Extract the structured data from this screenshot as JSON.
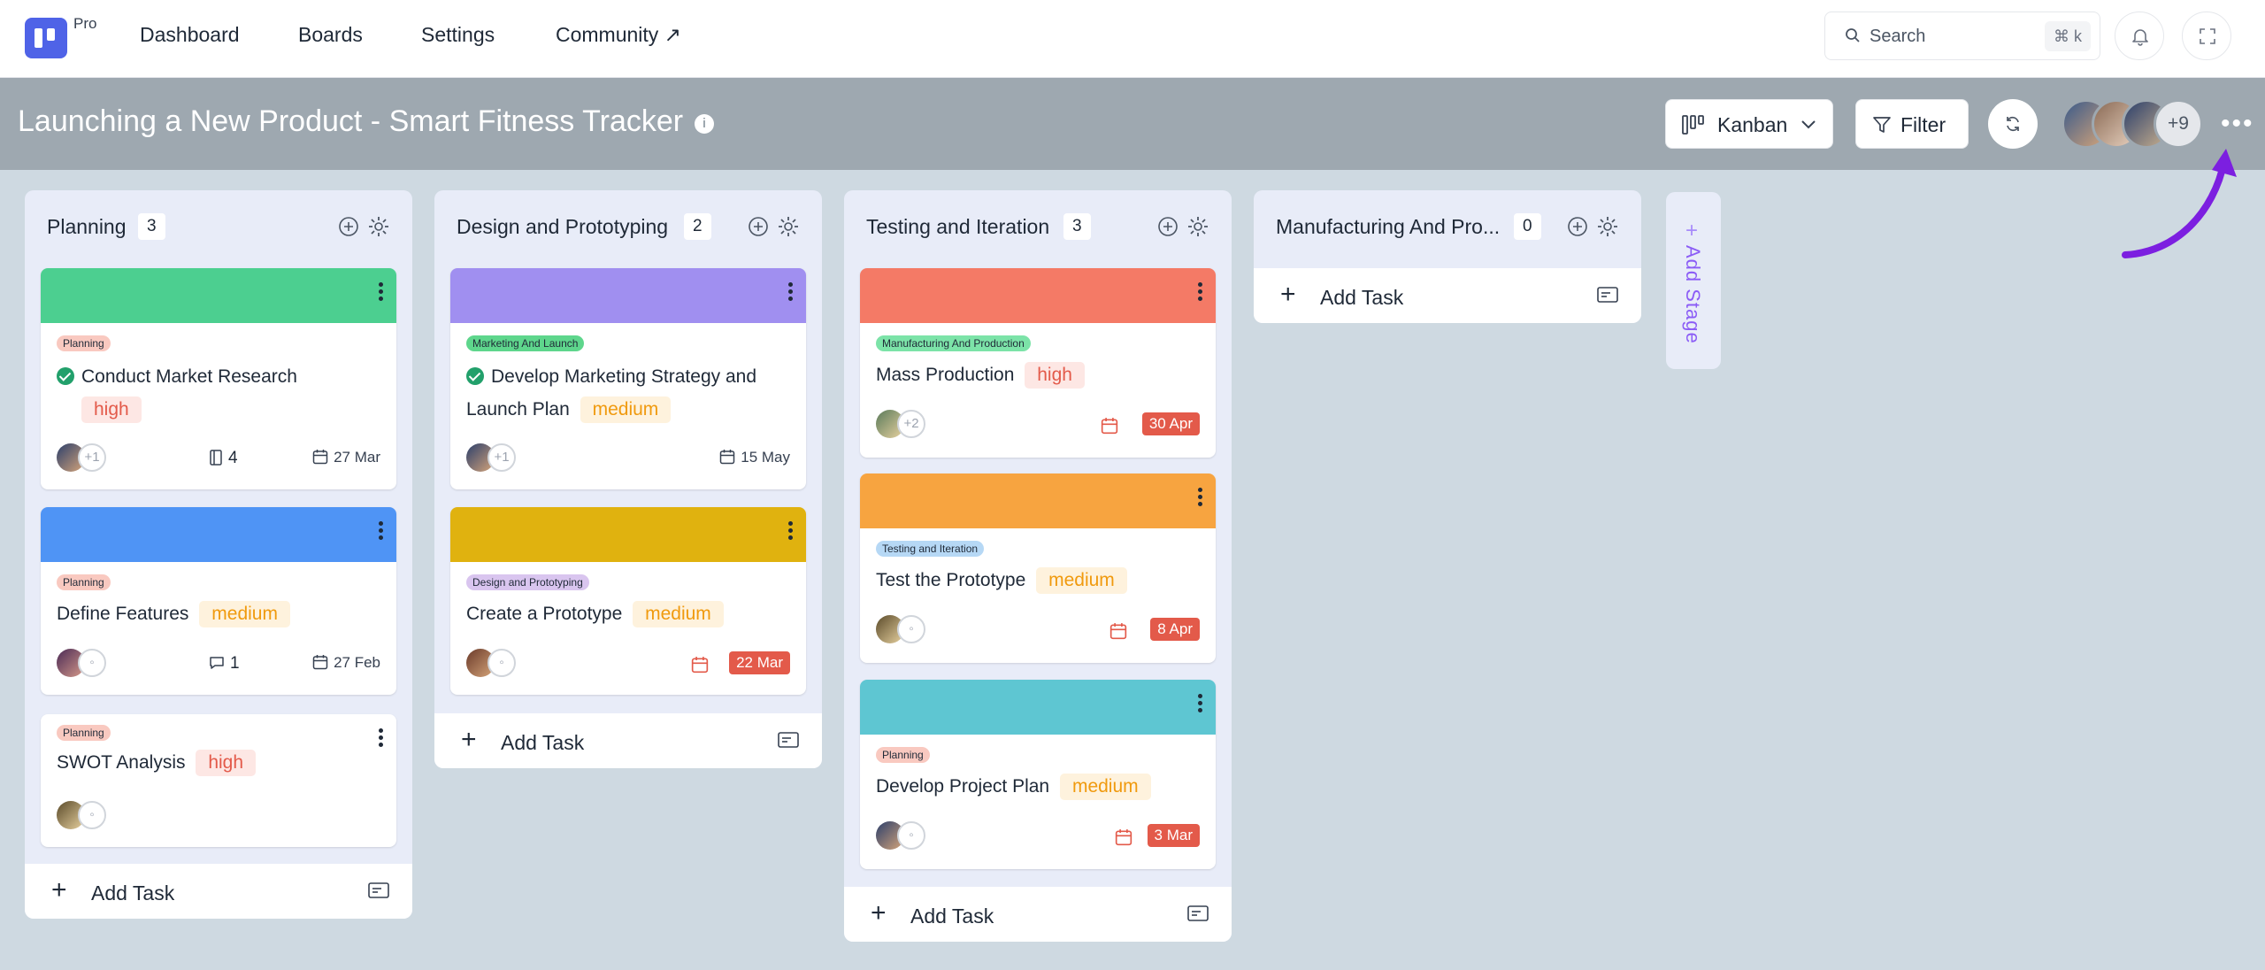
{
  "nav": {
    "plan_badge": "Pro",
    "links": [
      "Dashboard",
      "Boards",
      "Settings",
      "Community ↗"
    ],
    "search_placeholder": "Search",
    "search_shortcut": "⌘ k"
  },
  "board": {
    "title": "Launching a New Product - Smart Fitness Tracker",
    "view_label": "Kanban",
    "filter_label": "Filter",
    "members_more": "+9"
  },
  "columns": [
    {
      "title": "Planning",
      "count": "3",
      "cards": [
        {
          "cover_color": "#4ccf90",
          "tag": "Planning",
          "title": "Conduct Market Research",
          "priority": "high",
          "done": true,
          "assignees_extra": "+1",
          "attachments": "4",
          "date": "27 Mar"
        },
        {
          "cover_color": "#4f94f5",
          "tag": "Planning",
          "title": "Define Features",
          "priority": "medium",
          "comments": "1",
          "date": "27 Feb"
        },
        {
          "tag": "Planning",
          "title": "SWOT Analysis",
          "priority": "high"
        }
      ],
      "add_label": "Add Task"
    },
    {
      "title": "Design and Prototyping",
      "count": "2",
      "cards": [
        {
          "cover_color": "#a08ff0",
          "tag": "Marketing And Launch",
          "title": "Develop Marketing Strategy and Launch Plan",
          "priority": "medium",
          "done": true,
          "assignees_extra": "+1",
          "date": "15 May"
        },
        {
          "cover_color": "#e0b20f",
          "tag": "Design and Prototyping",
          "title": "Create a Prototype",
          "priority": "medium",
          "due": "22 Mar"
        }
      ],
      "add_label": "Add Task"
    },
    {
      "title": "Testing and Iteration",
      "count": "3",
      "cards": [
        {
          "cover_color": "#f47a66",
          "tag": "Manufacturing And Production",
          "title": "Mass Production",
          "priority": "high",
          "assignees_extra": "+2",
          "due": "30 Apr"
        },
        {
          "cover_color": "#f7a440",
          "tag": "Testing and Iteration",
          "title": "Test the Prototype",
          "priority": "medium",
          "due": "8 Apr"
        },
        {
          "cover_color": "#5ec6d2",
          "tag": "Planning",
          "title": "Develop Project Plan",
          "priority": "medium",
          "due": "3 Mar"
        }
      ],
      "add_label": "Add Task"
    },
    {
      "title": "Manufacturing And Pro...",
      "count": "0",
      "cards": [],
      "add_label": "Add Task"
    }
  ],
  "add_stage_label": "Add Stage",
  "colors": {
    "brand": "#4f63e7",
    "header_bg": "#9ea8b0",
    "board_bg": "#ced9e1",
    "column_bg": "#e8ecf8",
    "arrow": "#7c1fe0"
  }
}
